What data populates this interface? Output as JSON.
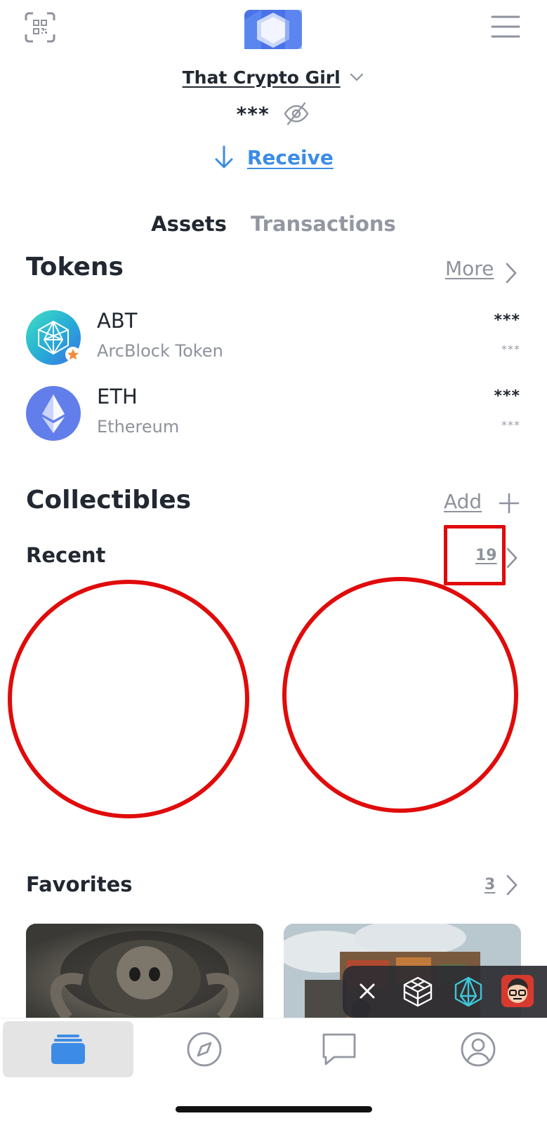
{
  "header": {
    "account_name": "That Crypto Girl",
    "balance_masked": "***",
    "receive_label": "Receive"
  },
  "tabs": [
    {
      "label": "Assets",
      "active": true
    },
    {
      "label": "Transactions",
      "active": false
    }
  ],
  "tokens": {
    "title": "Tokens",
    "more_label": "More",
    "items": [
      {
        "symbol": "ABT",
        "name": "ArcBlock Token",
        "amount": "***",
        "fiat": "***",
        "icon": "arcblock-icon"
      },
      {
        "symbol": "ETH",
        "name": "Ethereum",
        "amount": "***",
        "fiat": "***",
        "icon": "ethereum-icon"
      }
    ]
  },
  "collectibles": {
    "title": "Collectibles",
    "add_label": "Add",
    "recent": {
      "label": "Recent",
      "count": "19"
    },
    "favorites": {
      "label": "Favorites",
      "count": "3"
    }
  },
  "colors": {
    "accent": "#3c8ce7",
    "annotation_red": "#e00b0b",
    "text_primary": "#222831",
    "text_secondary": "#8e929c",
    "nav_active": "#3c8ce7"
  },
  "bottom_nav": [
    {
      "name": "wallet",
      "icon": "wallet-icon",
      "active": true
    },
    {
      "name": "explore",
      "icon": "compass-icon",
      "active": false
    },
    {
      "name": "messages",
      "icon": "chat-icon",
      "active": false
    },
    {
      "name": "profile",
      "icon": "user-icon",
      "active": false
    }
  ]
}
